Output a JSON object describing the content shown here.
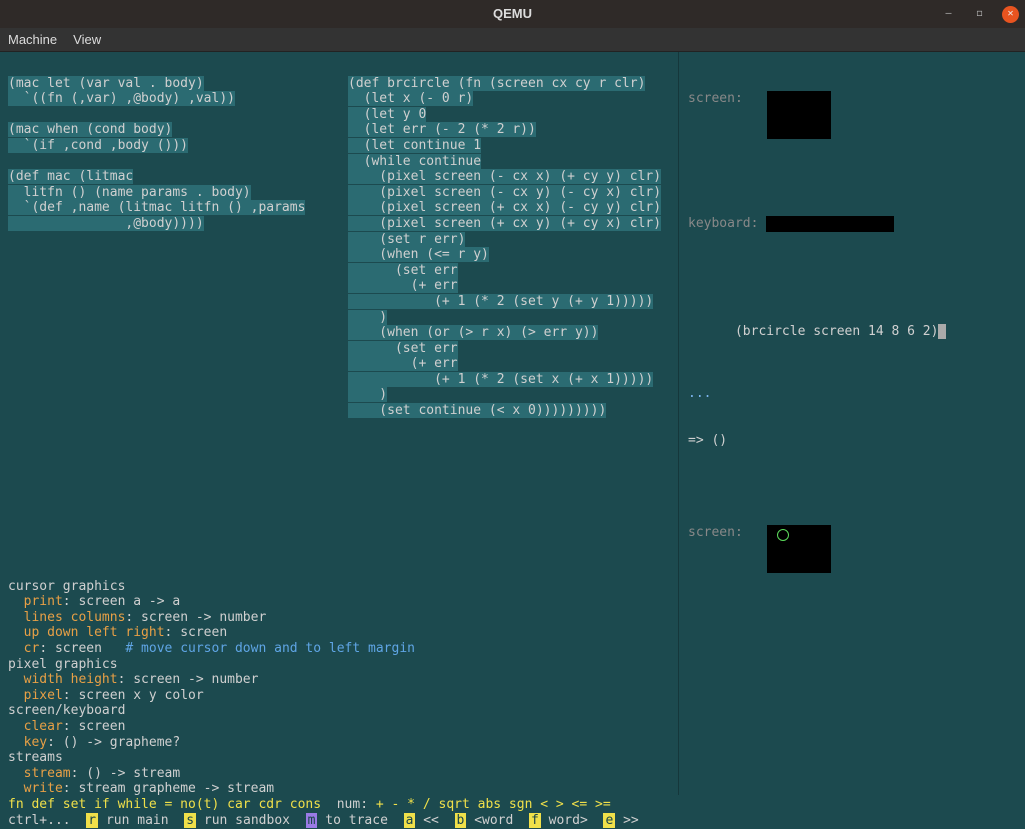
{
  "window": {
    "title": "QEMU"
  },
  "menu": {
    "machine": "Machine",
    "view": "View"
  },
  "code1": {
    "l1": "(mac let (var val . body)",
    "l2": "  `((fn (,var) ,@body) ,val))",
    "l3": "(mac when (cond body)",
    "l4": "  `(if ,cond ,body ()))",
    "l5": "(def mac (litmac",
    "l6": "  litfn () (name params . body)",
    "l7": "  `(def ,name (litmac litfn () ,params",
    "l8": "               ,@body))))"
  },
  "code2": {
    "l1": "(def brcircle (fn (screen cx cy r clr)",
    "l2": "  (let x (- 0 r)",
    "l3": "  (let y 0",
    "l4": "  (let err (- 2 (* 2 r))",
    "l5": "  (let continue 1",
    "l6": "  (while continue",
    "l7": "    (pixel screen (- cx x) (+ cy y) clr)",
    "l8": "    (pixel screen (- cx y) (- cy x) clr)",
    "l9": "    (pixel screen (+ cx x) (- cy y) clr)",
    "l10": "    (pixel screen (+ cx y) (+ cy x) clr)",
    "l11": "    (set r err)",
    "l12": "    (when (<= r y)",
    "l13": "      (set err",
    "l14": "        (+ err",
    "l15": "           (+ 1 (* 2 (set y (+ y 1)))))",
    "l16": "    )",
    "l17": "    (when (or (> r x) (> err y))",
    "l18": "      (set err",
    "l19": "        (+ err",
    "l20": "           (+ 1 (* 2 (set x (+ x 1)))))",
    "l21": "    )",
    "l22": "    (set continue (< x 0)))))))))"
  },
  "repl": {
    "label_screen": "screen:",
    "label_keyboard": "keyboard:",
    "input": "(brcircle screen 14 8 6 2)",
    "dots": "...",
    "result": "=> ()"
  },
  "help": {
    "cursor_graphics": "cursor graphics",
    "print": "print",
    "print_sig": ": screen a -> a",
    "lines_columns": "lines columns",
    "lines_columns_sig": ": screen -> number",
    "udlr": "up down left right",
    "udlr_sig": ": screen",
    "cr": "cr",
    "cr_sig": ": screen   ",
    "cr_comment": "# move cursor down and to left margin",
    "pixel_graphics": "pixel graphics",
    "wh": "width height",
    "wh_sig": ": screen -> number",
    "pixel": "pixel",
    "pixel_sig": ": screen x y color",
    "skb": "screen/keyboard",
    "clear": "clear",
    "clear_sig": ": screen",
    "key": "key",
    "key_sig": ": () -> grapheme?",
    "streams": "streams",
    "stream": "stream",
    "stream_sig": ": () -> stream",
    "write": "write",
    "write_sig": ": stream grapheme -> stream"
  },
  "status": {
    "builtins_y": "fn def set if while = no(t) car cdr cons",
    "num_label": "  num: ",
    "num_ops": "+ - * / sqrt abs sgn < > <= >=",
    "ctrl_prefix": "ctrl+...",
    "k_r": "r",
    "run_main": "run main",
    "k_s": "s",
    "run_sandbox": "run sandbox",
    "k_m": "m",
    "to_trace": "to trace",
    "k_a": "a",
    "op_a": "<<",
    "k_b": "b",
    "op_b": "<word",
    "k_f": "f",
    "op_f": "word>",
    "k_e": "e",
    "op_e": ">>"
  }
}
